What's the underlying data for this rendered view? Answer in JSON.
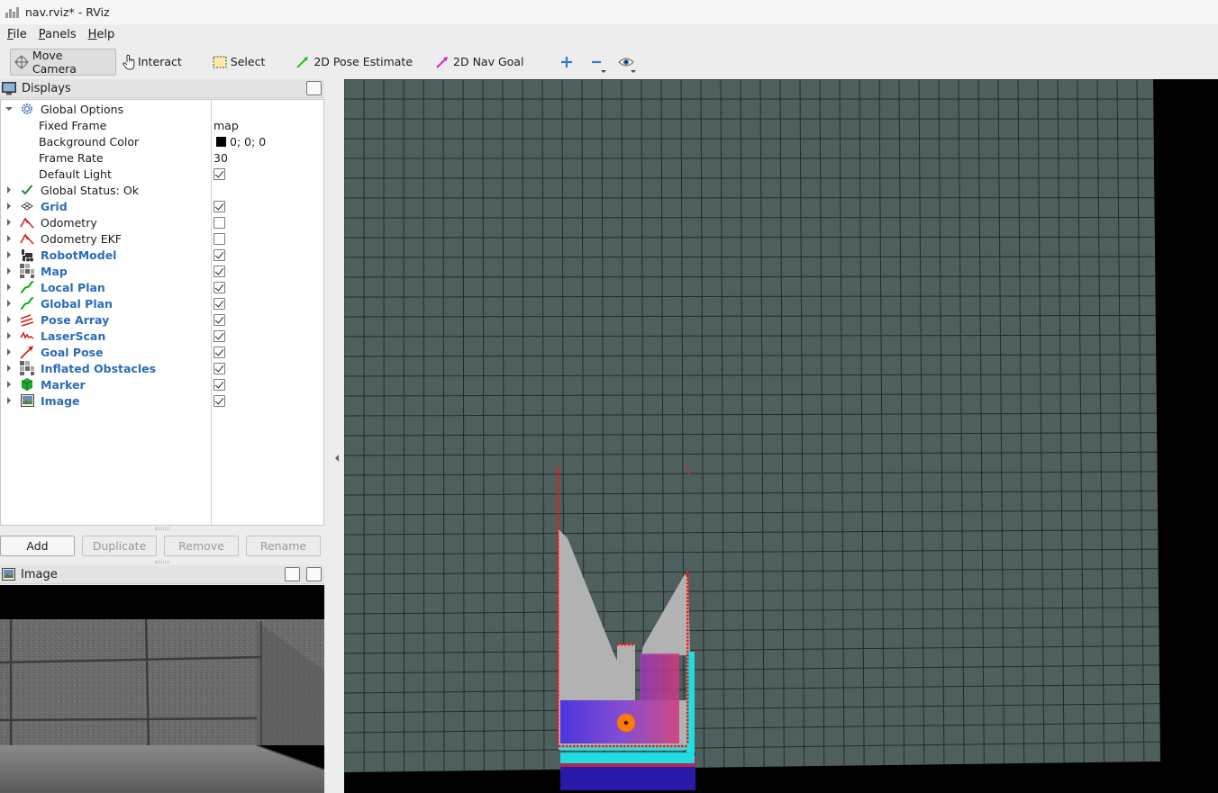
{
  "window": {
    "title": "nav.rviz* - RViz"
  },
  "menu": [
    {
      "label": "File",
      "mnemonic": "F",
      "rest": "ile"
    },
    {
      "label": "Panels",
      "mnemonic": "P",
      "rest": "anels"
    },
    {
      "label": "Help",
      "mnemonic": "H",
      "rest": "elp"
    }
  ],
  "toolbar": {
    "move_camera": "Move Camera",
    "interact": "Interact",
    "select": "Select",
    "pose_estimate": "2D Pose Estimate",
    "nav_goal": "2D Nav Goal",
    "icons": [
      "crosshair-plus-icon",
      "minus-icon",
      "eye-icon"
    ]
  },
  "displays": {
    "title": "Displays",
    "global_options": "Global Options",
    "fixed_frame": {
      "label": "Fixed Frame",
      "value": "map"
    },
    "background_color": {
      "label": "Background Color",
      "value": "0; 0; 0",
      "color": "#000000"
    },
    "frame_rate": {
      "label": "Frame Rate",
      "value": "30"
    },
    "default_light": {
      "label": "Default Light",
      "checked": true
    },
    "global_status": "Global Status: Ok",
    "items": [
      {
        "label": "Grid",
        "checked": true,
        "icon": "grid-icon",
        "highlight": true
      },
      {
        "label": "Odometry",
        "checked": false,
        "icon": "odometry-icon",
        "highlight": false
      },
      {
        "label": "Odometry EKF",
        "checked": false,
        "icon": "odometry-icon",
        "highlight": false
      },
      {
        "label": "RobotModel",
        "checked": true,
        "icon": "robot-model-icon",
        "highlight": true
      },
      {
        "label": "Map",
        "checked": true,
        "icon": "map-icon",
        "highlight": true
      },
      {
        "label": "Local Plan",
        "checked": true,
        "icon": "path-icon",
        "highlight": true
      },
      {
        "label": "Global Plan",
        "checked": true,
        "icon": "path-icon",
        "highlight": true
      },
      {
        "label": "Pose Array",
        "checked": true,
        "icon": "pose-array-icon",
        "highlight": true
      },
      {
        "label": "LaserScan",
        "checked": true,
        "icon": "laser-scan-icon",
        "highlight": true
      },
      {
        "label": "Goal Pose",
        "checked": true,
        "icon": "pose-icon",
        "highlight": true
      },
      {
        "label": "Inflated Obstacles",
        "checked": true,
        "icon": "map-icon",
        "highlight": true
      },
      {
        "label": "Marker",
        "checked": true,
        "icon": "marker-icon",
        "highlight": true
      },
      {
        "label": "Image",
        "checked": true,
        "icon": "image-icon",
        "highlight": true
      }
    ],
    "buttons": {
      "add": "Add",
      "duplicate": "Duplicate",
      "remove": "Remove",
      "rename": "Rename"
    }
  },
  "image_panel": {
    "title": "Image"
  },
  "colors": {
    "grid_bg": "#4f5f5d",
    "grid_line": "#1d2726",
    "highlight_text": "#2b6cb8",
    "laser": "#ff1010",
    "inflation": "#1ae6e6",
    "robot": "#ff7a00"
  }
}
